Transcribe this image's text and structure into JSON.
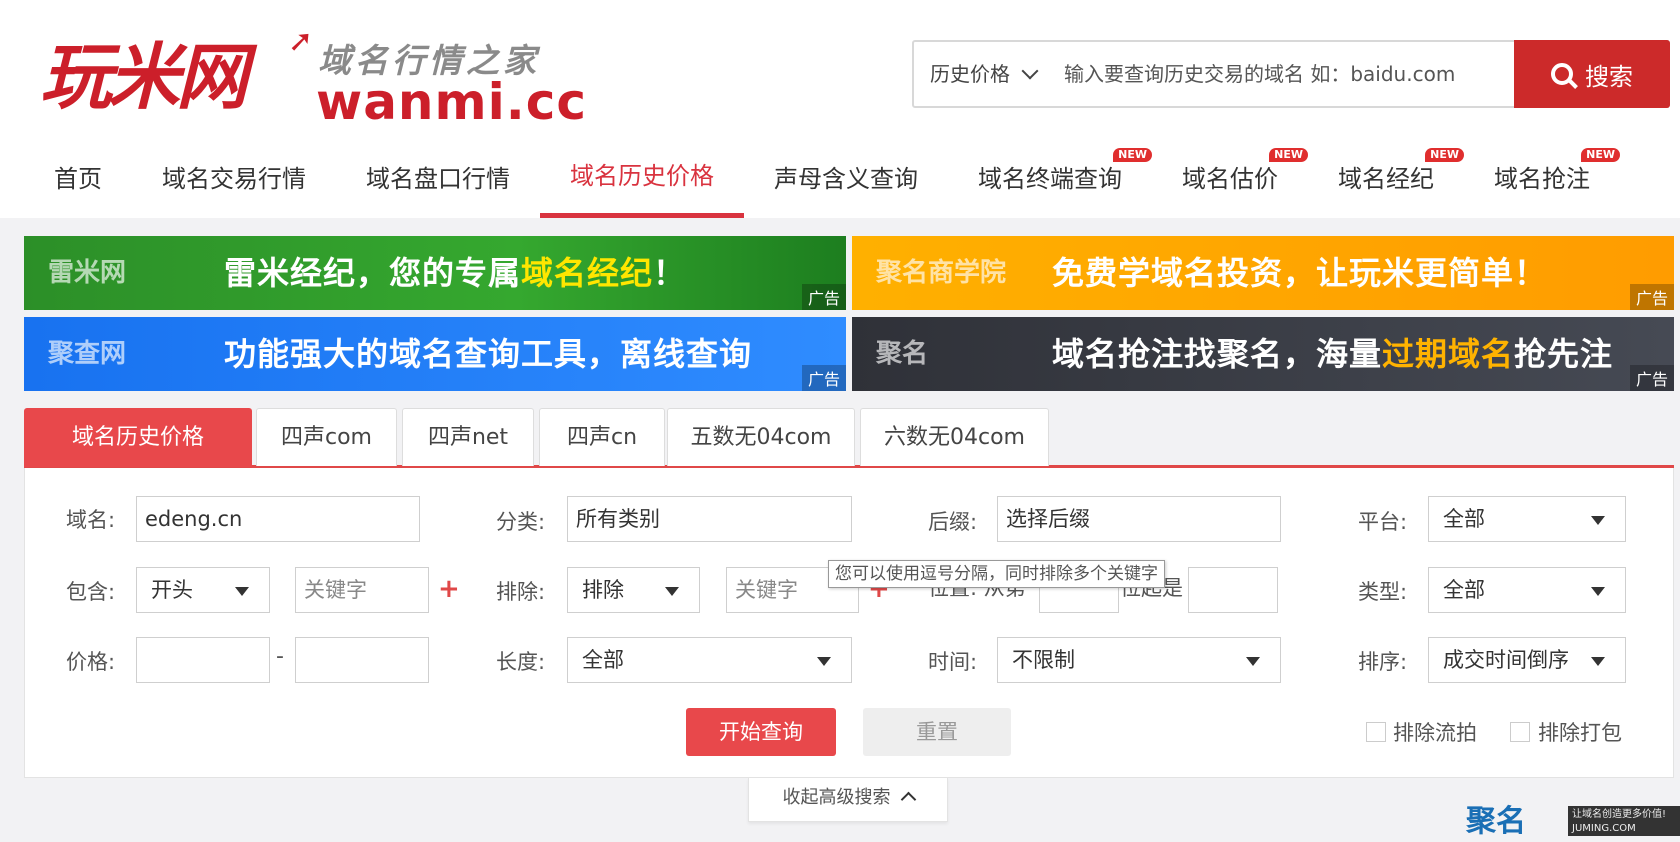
{
  "logo": {
    "brand": "玩米网",
    "slogan": "域名行情之家",
    "domain": "wanmi.cc"
  },
  "search": {
    "select_value": "历史价格",
    "placeholder": "输入要查询历史交易的域名 如：baidu.com",
    "button_label": "搜索"
  },
  "nav": {
    "items": [
      {
        "label": "首页"
      },
      {
        "label": "域名交易行情"
      },
      {
        "label": "域名盘口行情"
      },
      {
        "label": "域名历史价格"
      },
      {
        "label": "声母含义查询"
      },
      {
        "label": "域名终端查询",
        "badge": "NEW"
      },
      {
        "label": "域名估价",
        "badge": "NEW"
      },
      {
        "label": "域名经纪",
        "badge": "NEW"
      },
      {
        "label": "域名抢注",
        "badge": "NEW"
      }
    ]
  },
  "banners": [
    {
      "logo": "雷米网",
      "text_a": "雷米经纪，您的专属",
      "text_hl": "域名经纪",
      "text_b": "！",
      "ad": "广告",
      "color": "#2e9a2a"
    },
    {
      "logo": "聚名商学院",
      "text_a": "免费学域名投资，让玩米更简单！",
      "text_hl": "",
      "text_b": "",
      "ad": "广告",
      "color": "#ffa800"
    },
    {
      "logo": "聚查网",
      "text_a": "功能强大的域名查询工具，离线查询",
      "text_hl": "",
      "text_b": "",
      "ad": "广告",
      "color": "#1f7cf2"
    },
    {
      "logo": "聚名",
      "text_a": "域名抢注找聚名，海量",
      "text_hl": "过期域名",
      "text_b": "抢先注册！",
      "ad": "广告",
      "color": "#3a3d45"
    }
  ],
  "tabs": [
    {
      "label": "域名历史价格"
    },
    {
      "label": "四声com"
    },
    {
      "label": "四声net"
    },
    {
      "label": "四声cn"
    },
    {
      "label": "五数无04com"
    },
    {
      "label": "六数无04com"
    }
  ],
  "form": {
    "domain_label": "域名:",
    "domain_value": "edeng.cn",
    "category_label": "分类:",
    "category_value": "所有类别",
    "suffix_label": "后缀:",
    "suffix_placeholder": "选择后缀",
    "platform_label": "平台:",
    "platform_value": "全部",
    "include_label": "包含:",
    "include_mode": "开头",
    "include_keyword_placeholder": "关键字",
    "exclude_label": "排除:",
    "exclude_mode": "排除",
    "exclude_keyword_placeholder": "关键字",
    "position_label": "位置: 从第",
    "position_label_b": "位起是",
    "type_label": "类型:",
    "type_value": "全部",
    "price_label": "价格:",
    "price_sep": "-",
    "length_label": "长度:",
    "length_value": "全部",
    "time_label": "时间:",
    "time_value": "不限制",
    "sort_label": "排序:",
    "sort_value": "成交时间倒序",
    "plus": "+",
    "tooltip": "您可以使用逗号分隔，同时排除多个关键字"
  },
  "actions": {
    "query": "开始查询",
    "reset": "重置",
    "exclude_flow": "排除流拍",
    "exclude_pack": "排除打包",
    "collapse": "收起高级搜索"
  },
  "corner": {
    "brand": "聚名",
    "tagline": "让域名创造更多价值!",
    "site": "JUMING.COM"
  }
}
